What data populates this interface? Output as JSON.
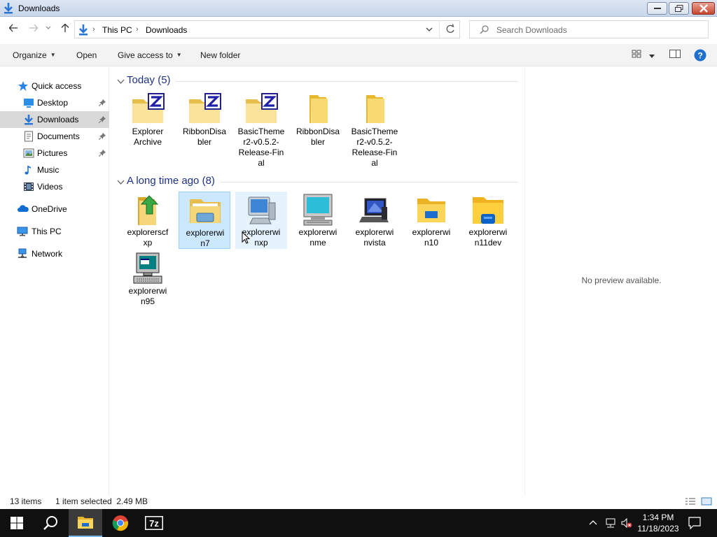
{
  "window": {
    "title": "Downloads",
    "controls": [
      "minimize",
      "maximize",
      "close"
    ]
  },
  "address": {
    "crumbs": [
      "This PC",
      "Downloads"
    ],
    "search_placeholder": "Search Downloads"
  },
  "toolbar": {
    "organize": "Organize",
    "open": "Open",
    "give_access": "Give access to",
    "new_folder": "New folder"
  },
  "sidebar": {
    "items": [
      {
        "label": "Quick access",
        "icon": "star-icon",
        "pinned": false
      },
      {
        "label": "Desktop",
        "icon": "desktop-icon",
        "pinned": true
      },
      {
        "label": "Downloads",
        "icon": "download-arrow-icon",
        "pinned": true,
        "selected": true
      },
      {
        "label": "Documents",
        "icon": "documents-icon",
        "pinned": true
      },
      {
        "label": "Pictures",
        "icon": "pictures-icon",
        "pinned": true
      },
      {
        "label": "Music",
        "icon": "music-note-icon",
        "pinned": false
      },
      {
        "label": "Videos",
        "icon": "videos-icon",
        "pinned": false
      },
      {
        "label": "OneDrive",
        "icon": "cloud-icon",
        "pinned": false
      },
      {
        "label": "This PC",
        "icon": "computer-icon",
        "pinned": false
      },
      {
        "label": "Network",
        "icon": "network-icon",
        "pinned": false
      }
    ]
  },
  "groups": [
    {
      "header": "Today (5)",
      "items": [
        {
          "label": "Explorer\nArchive",
          "icon": "zip-folder-icon"
        },
        {
          "label": "RibbonDisa\nbler",
          "icon": "zip-folder-icon"
        },
        {
          "label": "BasicTheme\nr2-v0.5.2-\nRelease-Fin\nal",
          "icon": "zip-folder-icon"
        },
        {
          "label": "RibbonDisa\nbler",
          "icon": "folder-icon"
        },
        {
          "label": "BasicTheme\nr2-v0.5.2-\nRelease-Fin\nal",
          "icon": "folder-icon"
        }
      ]
    },
    {
      "header": "A long time ago (8)",
      "items": [
        {
          "label": "explorerscf\nxp",
          "icon": "folder-arrow-icon"
        },
        {
          "label": "explorerwi\nn7",
          "icon": "win7-explorer-icon",
          "selected": true
        },
        {
          "label": "explorerwi\nnxp",
          "icon": "xp-computer-icon",
          "hover": true
        },
        {
          "label": "explorerwi\nnme",
          "icon": "crt-monitor-icon"
        },
        {
          "label": "explorerwi\nnvista",
          "icon": "vista-computer-icon"
        },
        {
          "label": "explorerwi\nn10",
          "icon": "win10-explorer-icon"
        },
        {
          "label": "explorerwi\nn11dev",
          "icon": "win11-explorer-icon"
        },
        {
          "label": "explorerwi\nn95",
          "icon": "win95-computer-icon"
        }
      ]
    }
  ],
  "preview": {
    "text": "No preview available."
  },
  "status": {
    "count": "13 items",
    "selection": "1 item selected  2.49 MB"
  },
  "taskbar": {
    "time": "1:34 PM",
    "date": "11/18/2023",
    "pinned": [
      "start-icon",
      "search-icon",
      "file-explorer-icon",
      "chrome-icon",
      "7zip-icon"
    ]
  },
  "colors": {
    "group_header": "#1e3287",
    "selection": "#cce8ff",
    "sidebar_selected": "#d9d9d9",
    "taskbar": "#101010",
    "accent": "#76b9ed"
  }
}
